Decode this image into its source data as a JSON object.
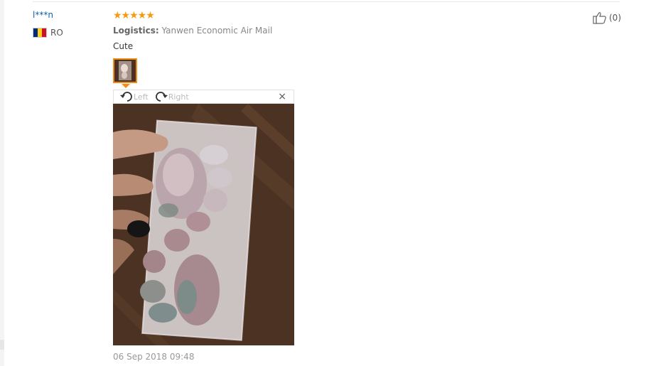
{
  "review": {
    "username": "l***n",
    "country_code": "RO",
    "rating_stars": "★★★★★",
    "rating": 5,
    "logistics_label": "Logistics:",
    "logistics_value": " Yanwen Economic Air Mail",
    "comment": "Cute",
    "date": "06 Sep 2018 09:48",
    "useful_count": "(0)"
  },
  "viewer": {
    "rotate_left_label": "Left",
    "rotate_right_label": "Right",
    "close_label": "×"
  },
  "icons": {
    "flag": "romania-flag-icon",
    "thumbs_up": "thumbs-up-icon",
    "rotate_left": "rotate-left-icon",
    "rotate_right": "rotate-right-icon",
    "close": "close-icon"
  },
  "colors": {
    "username": "#0d5fb3",
    "stars": "#f39c12",
    "thumb_border": "#f08c1a",
    "flag_blue": "#002b7f",
    "flag_yellow": "#fcd116",
    "flag_red": "#ce1126"
  }
}
